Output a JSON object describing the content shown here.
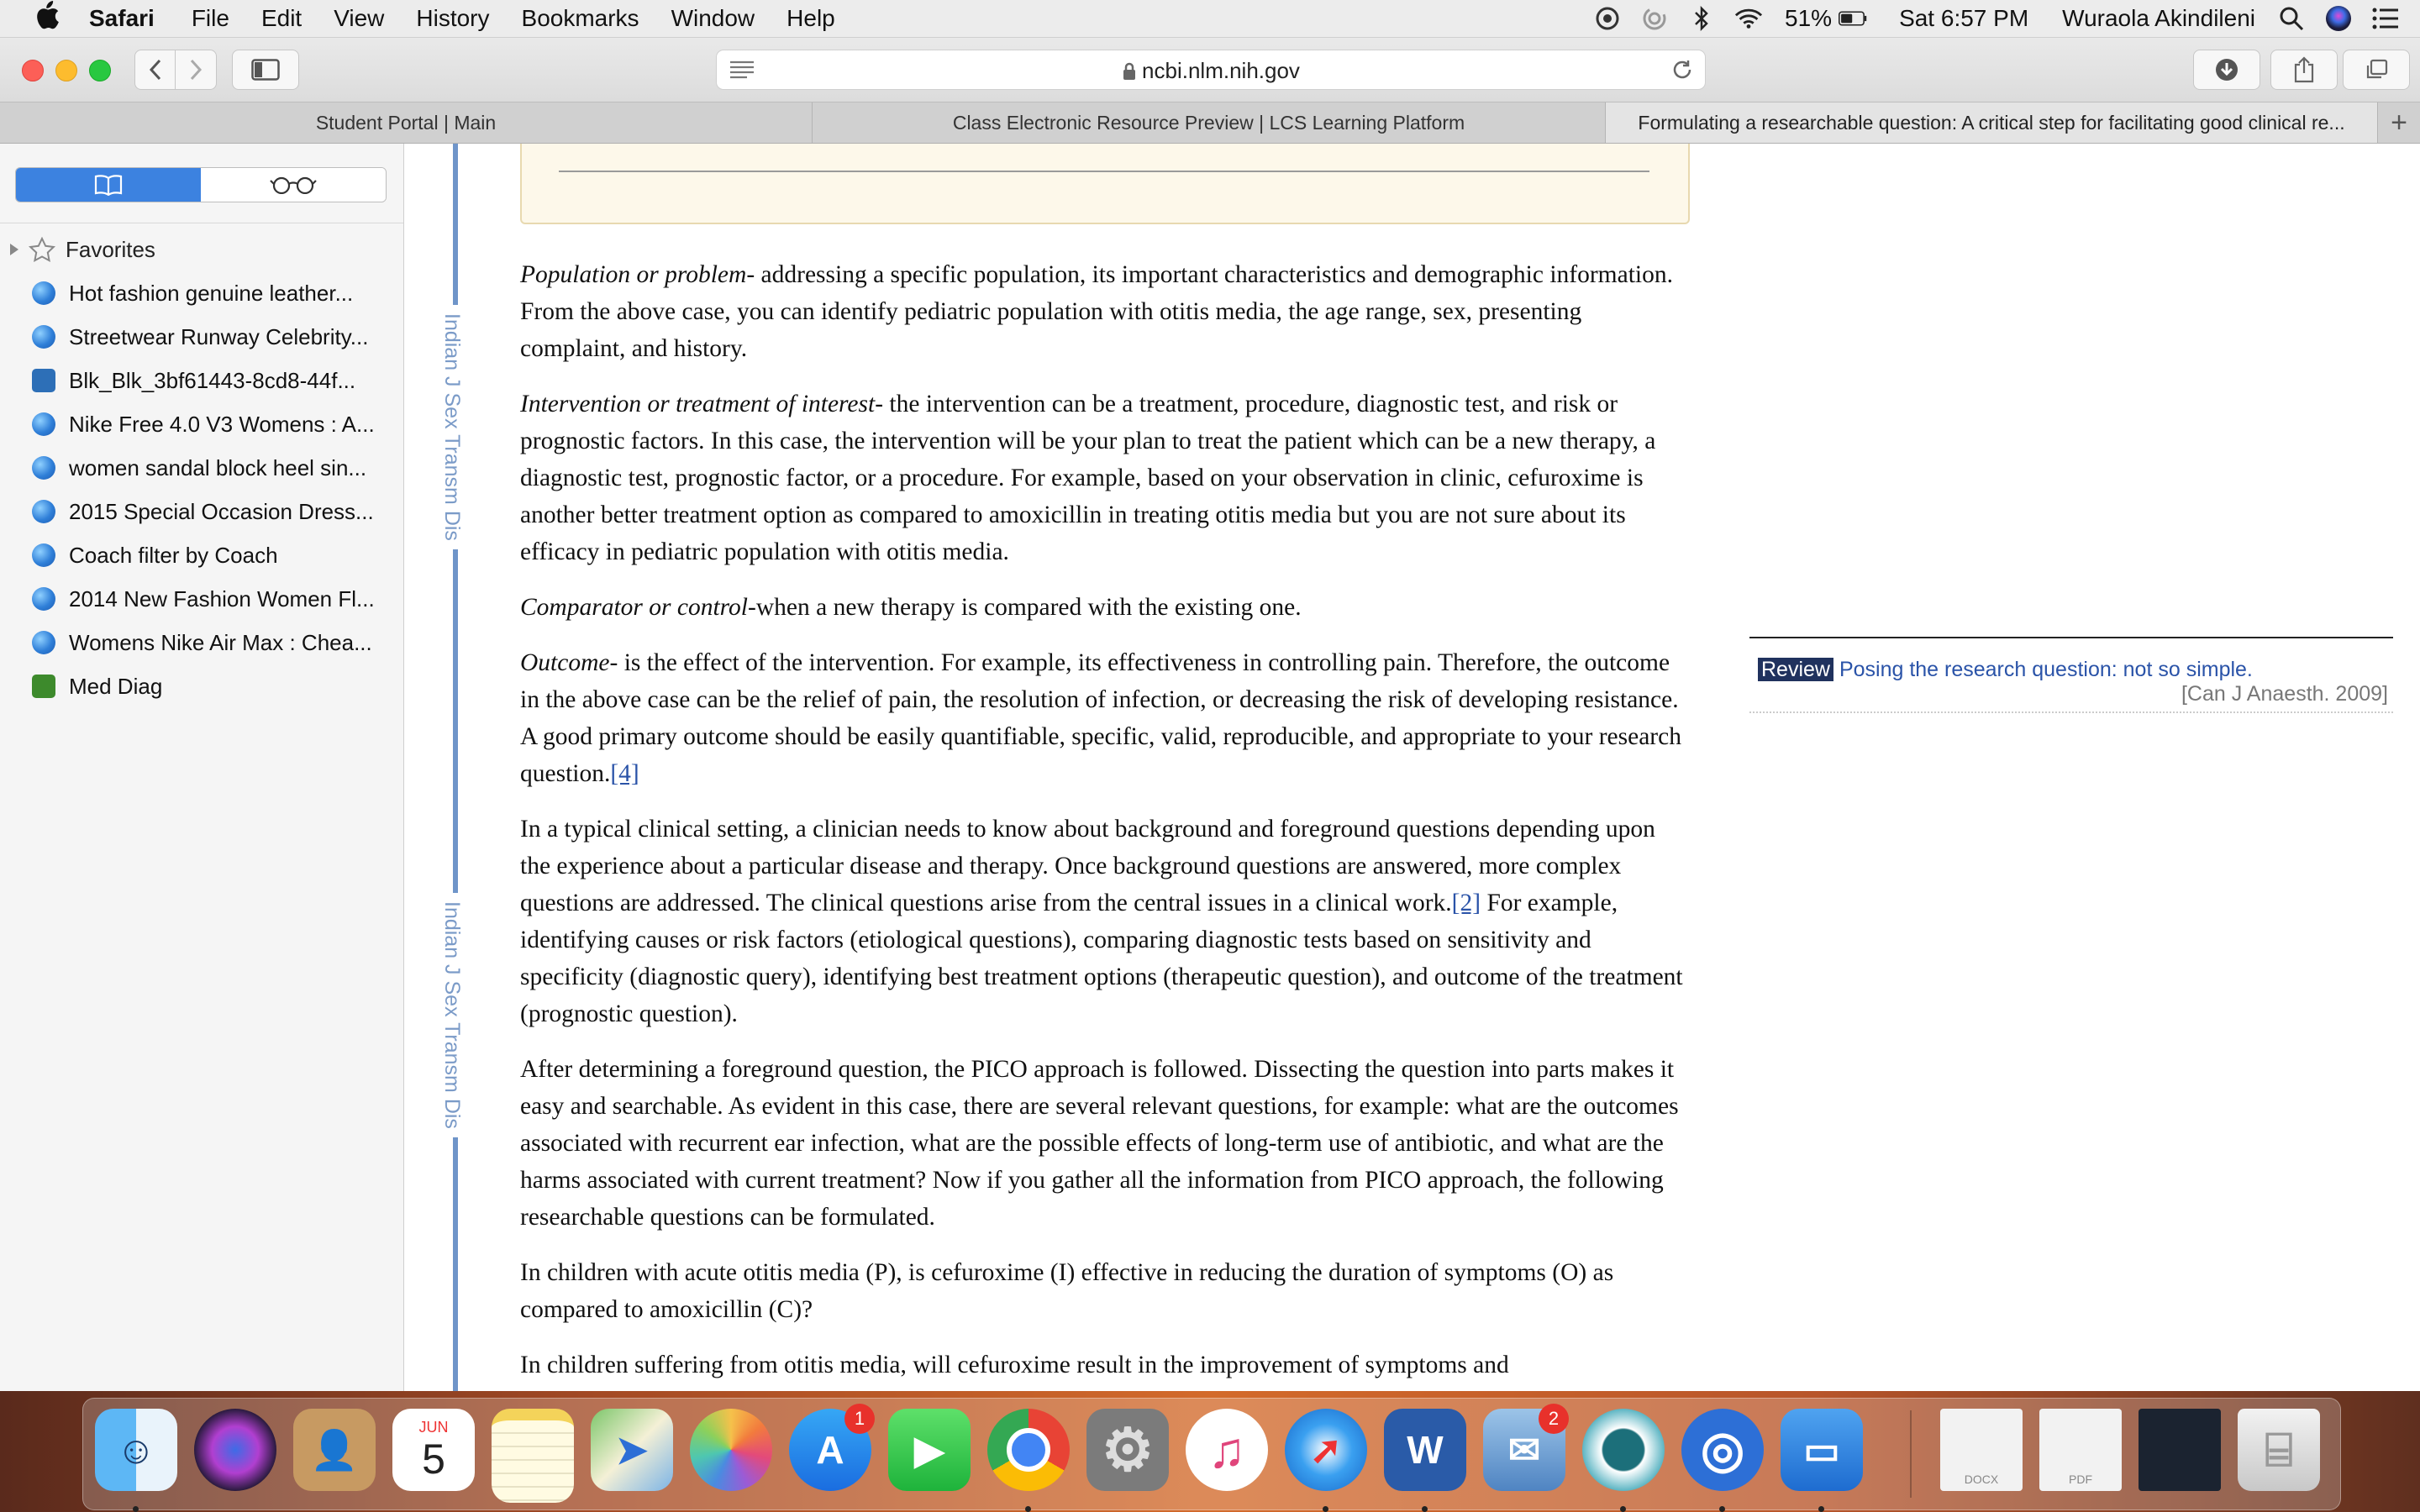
{
  "menubar": {
    "app_name": "Safari",
    "items": [
      "File",
      "Edit",
      "View",
      "History",
      "Bookmarks",
      "Window",
      "Help"
    ],
    "battery": "51%",
    "clock": "Sat 6:57 PM",
    "user": "Wuraola Akindileni"
  },
  "toolbar": {
    "url": "ncbi.nlm.nih.gov"
  },
  "tabs": [
    {
      "title": "Student Portal | Main"
    },
    {
      "title": "Class Electronic Resource Preview | LCS Learning Platform"
    },
    {
      "title": "Formulating a researchable question: A critical step for facilitating good clinical re..."
    }
  ],
  "sidebar": {
    "favorites_label": "Favorites",
    "bookmarks": [
      {
        "label": "Hot fashion genuine leather..."
      },
      {
        "label": "Streetwear Runway Celebrity..."
      },
      {
        "label": "Blk_Blk_3bf61443-8cd8-44f..."
      },
      {
        "label": "Nike Free 4.0 V3 Womens : A..."
      },
      {
        "label": "women sandal block heel sin..."
      },
      {
        "label": "2015 Special Occasion Dress..."
      },
      {
        "label": "Coach filter by Coach"
      },
      {
        "label": "2014 New Fashion Women Fl..."
      },
      {
        "label": "Womens Nike Air Max : Chea..."
      },
      {
        "label": "Med Diag"
      }
    ]
  },
  "journal_rail": {
    "label_1": "Indian J Sex Transm Dis",
    "label_2": "Indian J Sex Transm Dis"
  },
  "article": {
    "p1_lead": "Population or problem",
    "p1_text": "- addressing a specific population, its important characteristics and demographic information. From the above case, you can identify pediatric population with otitis media, the age range, sex, presenting complaint, and history.",
    "p2_lead": "Intervention or treatment of interest",
    "p2_text": "- the intervention can be a treatment, procedure, diagnostic test, and risk or prognostic factors. In this case, the intervention will be your plan to treat the patient which can be a new therapy, a diagnostic test, prognostic factor, or a procedure. For example, based on your observation in clinic, cefuroxime is another better treatment option as compared to amoxicillin in treating otitis media but you are not sure about its efficacy in pediatric population with otitis media.",
    "p3_lead": "Comparator or control",
    "p3_text": "-when a new therapy is compared with the existing one.",
    "p4_lead": "Outcome",
    "p4_text": "- is the effect of the intervention. For example, its effectiveness in controlling pain. Therefore, the outcome in the above case can be the relief of pain, the resolution of infection, or decreasing the risk of developing resistance. A good primary outcome should be easily quantifiable, specific, valid, reproducible, and appropriate to your research question.",
    "p4_ref": "[4]",
    "p5_text_a": "In a typical clinical setting, a clinician needs to know about background and foreground questions depending upon the experience about a particular disease and therapy. Once background questions are answered, more complex questions are addressed. The clinical questions arise from the central issues in a clinical work.",
    "p5_ref": "[2]",
    "p5_text_b": " For example, identifying causes or risk factors (etiological questions), comparing diagnostic tests based on sensitivity and specificity (diagnostic query), identifying best treatment options (therapeutic question), and outcome of the treatment (prognostic question).",
    "p6_text": "After determining a foreground question, the PICO approach is followed. Dissecting the question into parts makes it easy and searchable. As evident in this case, there are several relevant questions, for example: what are the outcomes associated with recurrent ear infection, what are the possible effects of long-term use of antibiotic, and what are the harms associated with current treatment? Now if you gather all the information from PICO approach, the following researchable questions can be formulated.",
    "p7_text": "In children with acute otitis media (P), is cefuroxime (I) effective in reducing the duration of symptoms (O) as compared to amoxicillin (C)?",
    "p8_text": "In children suffering from otitis media, will cefuroxime result in the improvement of symptoms and"
  },
  "related": {
    "badge": "Review",
    "title": "Posing the research question: not so simple.",
    "citation": "[Can J Anaesth. 2009]"
  },
  "dock": {
    "calendar_month": "JUN",
    "calendar_day": "5",
    "appstore_badge": "1",
    "mail_badge": "2",
    "word_letter": "W",
    "docx_label": "DOCX",
    "pdf_label": "PDF"
  },
  "colors": {
    "accent_blue": "#3c82e0",
    "journal_rail": "#6f95c9",
    "link": "#2a53a8",
    "badge_navy": "#20325e"
  }
}
